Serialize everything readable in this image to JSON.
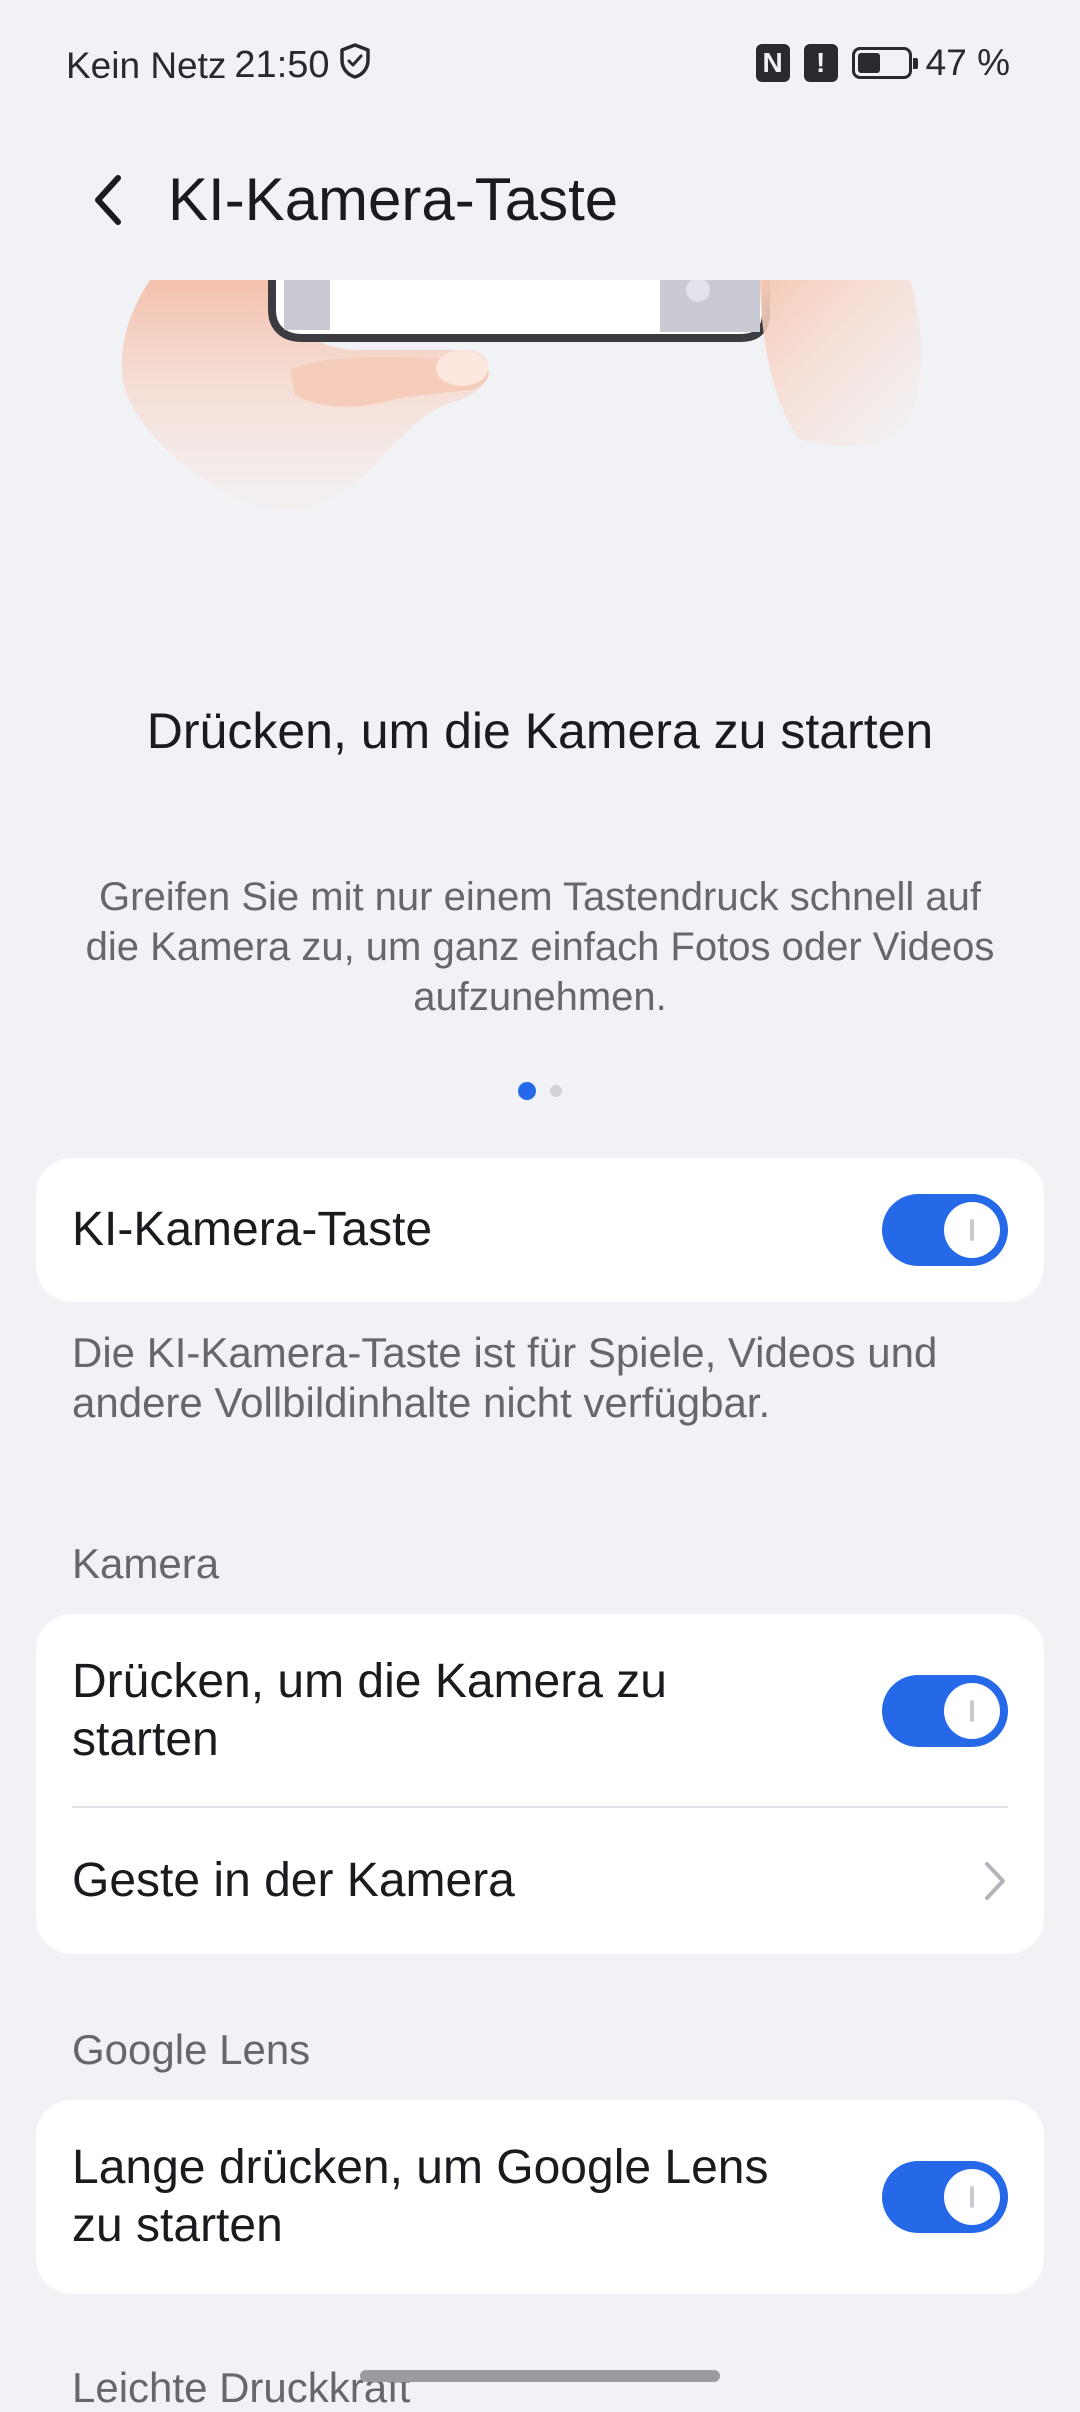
{
  "status_bar": {
    "carrier": "Kein Netz",
    "time": "21:50",
    "nfc_icon": "N",
    "alert_icon": "!",
    "battery_level": 0.47,
    "battery_text": "47 %"
  },
  "header": {
    "title": "KI-Kamera-Taste"
  },
  "intro": {
    "title": "Drücken, um die Kamera zu starten",
    "description": "Greifen Sie mit nur einem Tastendruck schnell auf die Kamera zu, um ganz einfach Fotos oder Videos aufzunehmen."
  },
  "main_toggle": {
    "label": "KI-Kamera-Taste",
    "enabled": true
  },
  "note": "Die KI-Kamera-Taste ist für Spiele, Videos und andere Vollbildinhalte nicht verfügbar.",
  "sections": {
    "camera": {
      "header": "Kamera",
      "press_label": "Drücken, um die Kamera zu starten",
      "press_enabled": true,
      "gesture_label": "Geste in der Kamera"
    },
    "lens": {
      "header": "Google Lens",
      "long_press_label": "Lange drücken, um Google Lens zu starten",
      "long_press_enabled": true
    },
    "pressure": {
      "header": "Leichte Druckkraft"
    }
  },
  "colors": {
    "accent": "#2669e8",
    "background": "#f1f2f6",
    "card": "#ffffff"
  }
}
